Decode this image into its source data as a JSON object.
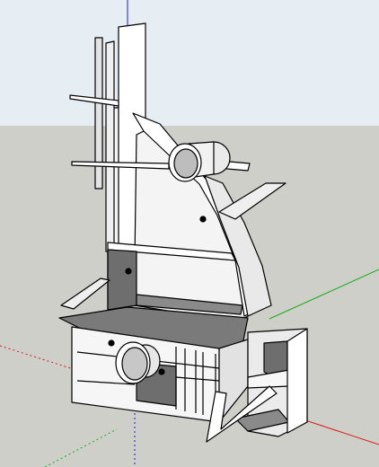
{
  "viewport": {
    "sky_color": "#E7EEF3",
    "ground_color": "#CFCFCA",
    "axis_colors": {
      "blue": "#1A1AE6",
      "red": "#D61D1D",
      "green": "#1BAA1B"
    }
  },
  "model": {
    "face_light": "#F4F4F4",
    "face_white": "#FFFFFF",
    "face_mid": "#D9D9D9",
    "face_dark": "#6E6E6E",
    "edge_color": "#000000"
  }
}
